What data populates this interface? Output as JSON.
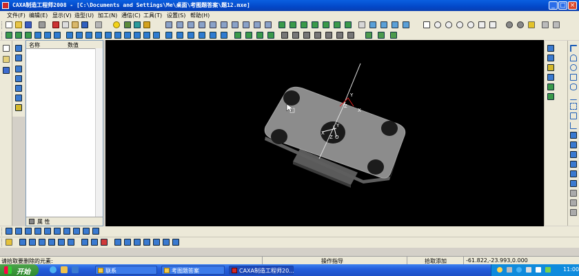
{
  "window": {
    "title": "CAXA制造工程师2008  - [C:\\Documents and Settings\\Me\\桌面\\考图题答案\\题12.mxe]"
  },
  "menu": [
    "文件(F)",
    "编辑(E)",
    "显示(V)",
    "造型(U)",
    "加工(N)",
    "通信(C)",
    "工具(T)",
    "设置(S)",
    "帮助(H)"
  ],
  "panel": {
    "col_name": "名称",
    "col_value": "数值",
    "tab_props": "属 性"
  },
  "canvas": {
    "axis_y_top": "Y",
    "axis_z_top": "Z",
    "axis_x_top": "X",
    "axis_y_mid": "Y",
    "axis_z_mid": "Z",
    "axis_x_mid": "X",
    "axis_o": "O"
  },
  "status": {
    "prompt": "请拾取要删除的元素:",
    "hint": "操作指导",
    "mode": "拾取添加",
    "coords": "-61.822,-23.993,0.000"
  },
  "taskbar": {
    "start": "开始",
    "tasks": [
      "联系",
      "考图题答案",
      "CAXA制造工程师20..."
    ],
    "clock": "11:00"
  },
  "colors": {
    "canvas": "#000000",
    "part": "#8c8c8c",
    "accent": "#0a5fe0"
  }
}
